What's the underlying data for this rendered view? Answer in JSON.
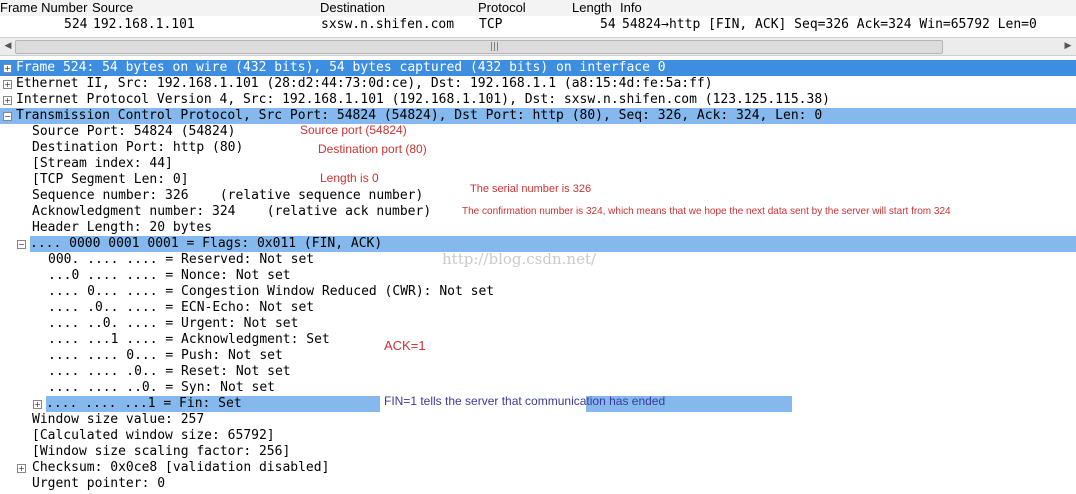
{
  "packet_list": {
    "columns": [
      "Frame Number",
      "Source",
      "Destination",
      "Protocol",
      "Length",
      "Info"
    ],
    "row": {
      "number": "524",
      "source": "192.168.1.101",
      "destination": "sxsw.n.shifen.com",
      "protocol": "TCP",
      "length": "54",
      "info": "54824→http [FIN, ACK] Seq=326 Ack=324 Win=65792 Len=0"
    },
    "scroll_grip": "|||"
  },
  "detail": {
    "frame": "Frame 524: 54 bytes on wire (432 bits), 54 bytes captured (432 bits) on interface 0",
    "ethernet": "Ethernet II, Src: 192.168.1.101 (28:d2:44:73:0d:ce), Dst: 192.168.1.1 (a8:15:4d:fe:5a:ff)",
    "ip": "Internet Protocol Version 4, Src: 192.168.1.101 (192.168.1.101), Dst: sxsw.n.shifen.com (123.125.115.38)",
    "tcp": "Transmission Control Protocol, Src Port: 54824 (54824), Dst Port: http (80), Seq: 326, Ack: 324, Len: 0",
    "tcp_fields": [
      "Source Port: 54824 (54824)",
      "Destination Port: http (80)",
      "[Stream index: 44]",
      "[TCP Segment Len: 0]",
      "Sequence number: 326    (relative sequence number)",
      "Acknowledgment number: 324    (relative ack number)",
      "Header Length: 20 bytes"
    ],
    "flags": ".... 0000 0001 0001 = Flags: 0x011 (FIN, ACK)",
    "flag_bits": [
      "000. .... .... = Reserved: Not set",
      "...0 .... .... = Nonce: Not set",
      ".... 0... .... = Congestion Window Reduced (CWR): Not set",
      ".... .0.. .... = ECN-Echo: Not set",
      ".... ..0. .... = Urgent: Not set",
      ".... ...1 .... = Acknowledgment: Set",
      ".... .... 0... = Push: Not set",
      ".... .... .0.. = Reset: Not set",
      ".... .... ..0. = Syn: Not set"
    ],
    "fin": ".... .... ...1 = Fin: Set",
    "after_flags": [
      "Window size value: 257",
      "[Calculated window size: 65792]",
      "[Window size scaling factor: 256]"
    ],
    "checksum": "Checksum: 0x0ce8 [validation disabled]",
    "urgent": "Urgent pointer: 0"
  },
  "annotations": {
    "source_port": "Source port (54824)",
    "destination_port": "Destination port (80)",
    "length": "Length is 0",
    "serial": "The serial number is 326",
    "confirmation": "The confirmation number is 324, which means that we hope the next data sent by the server will start from 324",
    "ack": "ACK=1",
    "fin": "FIN=1 tells the server that communication has ended"
  },
  "watermark": "http://blog.csdn.net/",
  "colors": {
    "selection": "#85b8ec",
    "frame_row": "#3d8ee0",
    "annotation": "#cc3333"
  }
}
